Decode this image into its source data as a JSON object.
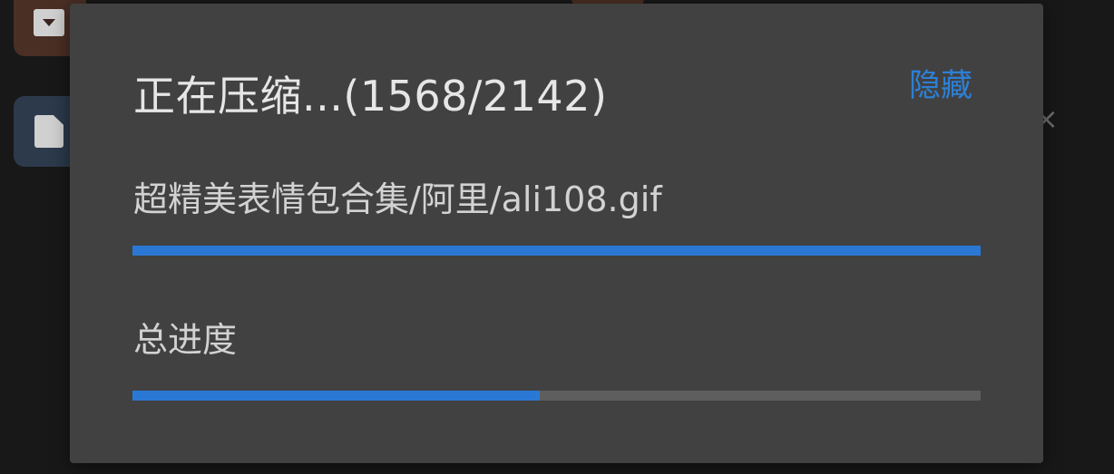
{
  "dialog": {
    "title": "正在压缩...(1568/2142)",
    "hide_label": "隐藏",
    "current_file": "超精美表情包合集/阿里/ali108.gif",
    "file_progress": 1.0,
    "overall_label": "总进度",
    "overall_progress": 0.48
  },
  "background": {
    "close_glyph": "×"
  },
  "colors": {
    "accent": "#2a78d4",
    "dialog_bg": "#414141",
    "track": "#5e5e5e"
  }
}
